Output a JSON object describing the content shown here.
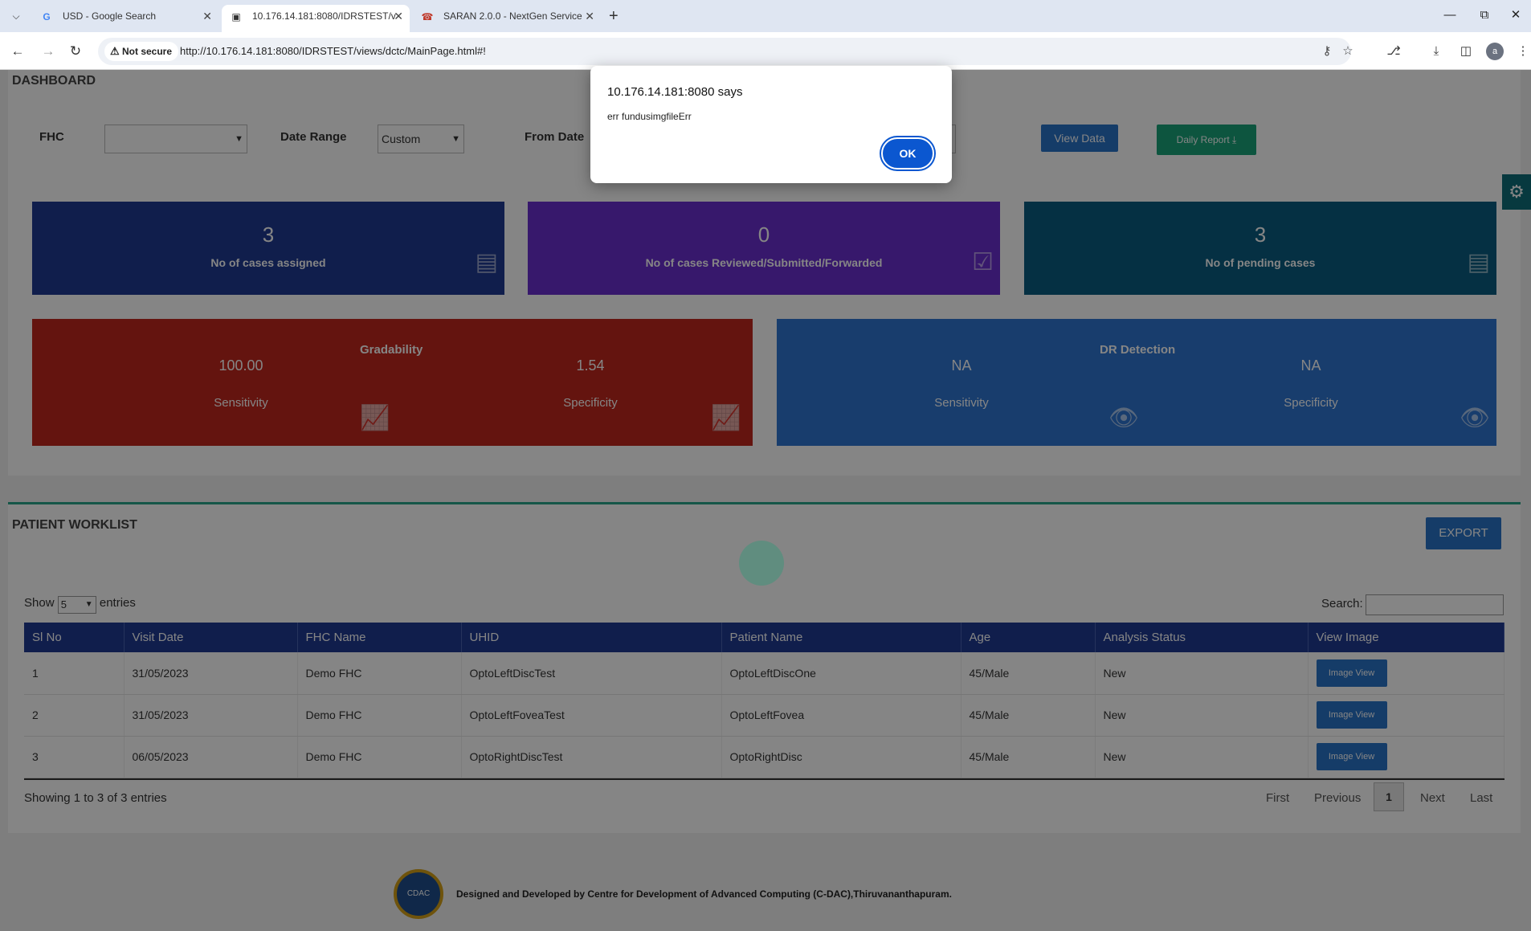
{
  "browser": {
    "tabs": [
      {
        "label": "USD - Google Search",
        "icon": "google-icon"
      },
      {
        "label": "10.176.14.181:8080/IDRSTEST/v",
        "icon": "image-icon"
      },
      {
        "label": "SARAN 2.0.0 - NextGen Service",
        "icon": "headset-icon"
      }
    ],
    "not_secure_label": "Not secure",
    "url": "http://10.176.14.181:8080/IDRSTEST/views/dctc/MainPage.html#!",
    "avatar_letter": "a"
  },
  "dashboard": {
    "title": "DASHBOARD",
    "fhc_label": "FHC",
    "fhc_value": "",
    "date_range_label": "Date Range",
    "date_range_value": "Custom",
    "from_date_label": "From Date",
    "view_data_label": "View Data",
    "daily_report_label": "Daily Report"
  },
  "cards": [
    {
      "value": "3",
      "label": "No of cases assigned",
      "color": "#1f3a93",
      "icon": "calendar-icon"
    },
    {
      "value": "0",
      "label": "No of cases Reviewed/Submitted/Forwarded",
      "color": "#6a2fd0",
      "icon": "clipboard-check-icon"
    },
    {
      "value": "3",
      "label": "No of pending cases",
      "color": "#0a5d80",
      "icon": "printer-icon"
    }
  ],
  "gradability": {
    "title": "Gradability",
    "sensitivity_value": "100.00",
    "sensitivity_label": "Sensitivity",
    "specificity_value": "1.54",
    "specificity_label": "Specificity",
    "color": "#c0281d"
  },
  "dr_detection": {
    "title": "DR Detection",
    "sensitivity_value": "NA",
    "sensitivity_label": "Sensitivity",
    "specificity_value": "NA",
    "specificity_label": "Specificity",
    "color": "#2f76d2"
  },
  "worklist": {
    "title": "PATIENT WORKLIST",
    "export_label": "EXPORT",
    "show_label": "Show",
    "entries_value": "5",
    "entries_label": "entries",
    "search_label": "Search:",
    "columns": [
      "Sl No",
      "Visit Date",
      "FHC Name",
      "UHID",
      "Patient Name",
      "Age",
      "Analysis Status",
      "View Image"
    ],
    "rows": [
      {
        "sl": "1",
        "date": "31/05/2023",
        "fhc": "Demo FHC",
        "uhid": "OptoLeftDiscTest",
        "name": "OptoLeftDiscOne",
        "age": "45/Male",
        "status": "New",
        "action": "Image View"
      },
      {
        "sl": "2",
        "date": "31/05/2023",
        "fhc": "Demo FHC",
        "uhid": "OptoLeftFoveaTest",
        "name": "OptoLeftFovea",
        "age": "45/Male",
        "status": "New",
        "action": "Image View"
      },
      {
        "sl": "3",
        "date": "06/05/2023",
        "fhc": "Demo FHC",
        "uhid": "OptoRightDiscTest",
        "name": "OptoRightDisc",
        "age": "45/Male",
        "status": "New",
        "action": "Image View"
      }
    ],
    "info": "Showing 1 to 3 of 3 entries",
    "pager": {
      "first": "First",
      "previous": "Previous",
      "current": "1",
      "next": "Next",
      "last": "Last"
    }
  },
  "footer": {
    "text": "Designed and Developed by Centre for Development of Advanced Computing (C-DAC),Thiruvananthapuram.",
    "logo_text": "CDAC"
  },
  "dialog": {
    "title": "10.176.14.181:8080 says",
    "message": "err fundusimgfileErr",
    "ok_label": "OK"
  }
}
